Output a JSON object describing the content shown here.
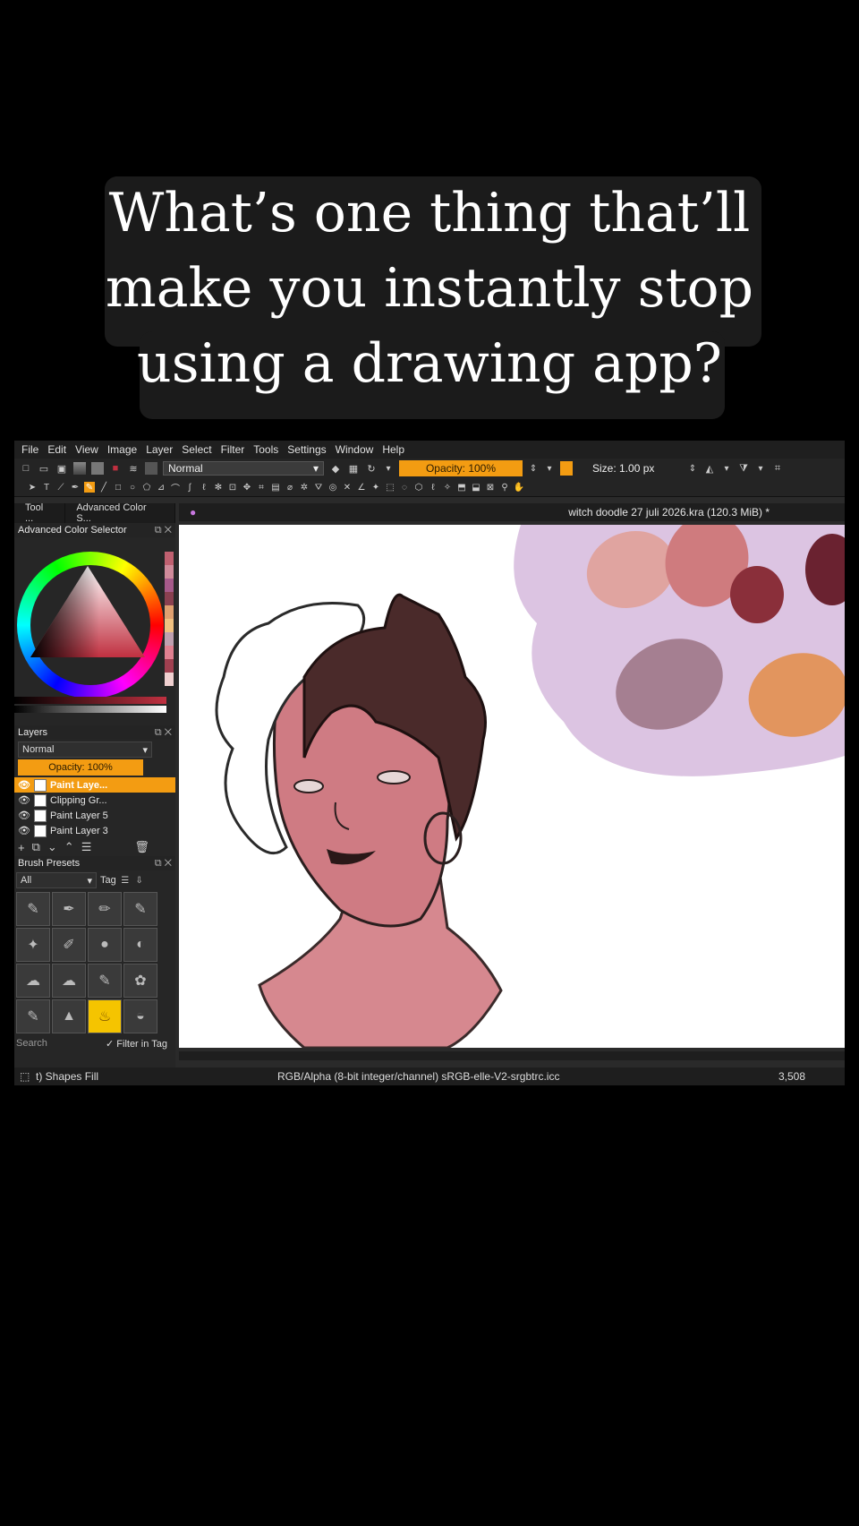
{
  "caption": {
    "line1": "What’s one thing that’ll",
    "line2": "make you instantly stop",
    "line3": "using a drawing app?"
  },
  "menu": [
    "File",
    "Edit",
    "View",
    "Image",
    "Layer",
    "Select",
    "Filter",
    "Tools",
    "Settings",
    "Window",
    "Help"
  ],
  "toolbar": {
    "blend_mode": "Normal",
    "opacity": "Opacity: 100%",
    "size": "Size: 1.00 px"
  },
  "left_panel": {
    "tab1": "Tool ...",
    "tab2": "Advanced Color S...",
    "color_dock_title": "Advanced Color Selector",
    "layers_title": "Layers",
    "layers_blend": "Normal",
    "layers_opacity": "Opacity: 100%",
    "layers": [
      "Paint Laye...",
      "Clipping Gr...",
      "Paint Layer 5",
      "Paint Layer 3"
    ],
    "brush_title": "Brush Presets",
    "brush_filter": "All",
    "brush_tag": "Tag",
    "search_placeholder": "Search",
    "filter_in_tag": "Filter in Tag"
  },
  "document": {
    "title": "witch doodle 27 juli 2026.kra (120.3 MiB) *"
  },
  "status": {
    "tool": "t) Shapes Fill",
    "color_profile": "RGB/Alpha (8-bit integer/channel)  sRGB-elle-V2-srgbtrc.icc",
    "size": "3,508"
  },
  "colors": {
    "accent": "#f39c12",
    "palette": [
      "#e0a4a0",
      "#cf7b7e",
      "#8a2f3a",
      "#a57f91",
      "#e2955e",
      "#dcc4e2"
    ]
  }
}
